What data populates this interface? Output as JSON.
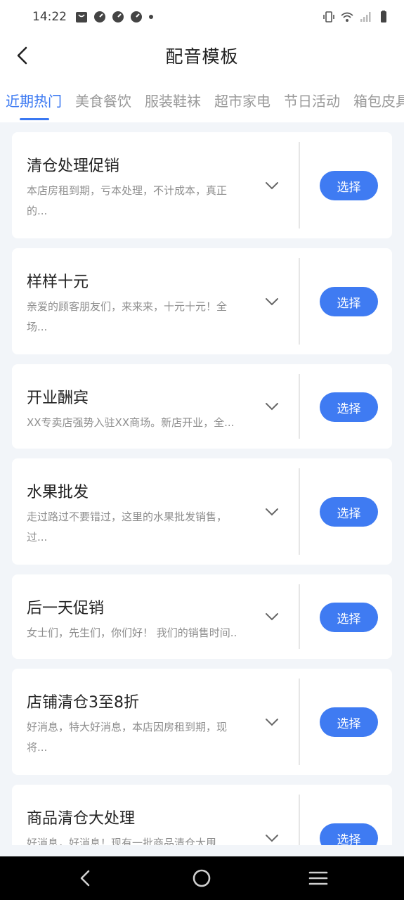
{
  "status": {
    "time": "14:22"
  },
  "header": {
    "title": "配音模板"
  },
  "tabs": [
    {
      "label": "近期热门",
      "active": true
    },
    {
      "label": "美食餐饮",
      "active": false
    },
    {
      "label": "服装鞋袜",
      "active": false
    },
    {
      "label": "超市家电",
      "active": false
    },
    {
      "label": "节日活动",
      "active": false
    },
    {
      "label": "箱包皮具",
      "active": false
    }
  ],
  "templates": [
    {
      "title": "清仓处理促销",
      "desc": "本店房租到期，亏本处理，不计成本，真正的...",
      "button": "选择"
    },
    {
      "title": "样样十元",
      "desc": "亲爱的顾客朋友们，来来来，十元十元！全场...",
      "button": "选择"
    },
    {
      "title": "开业酬宾",
      "desc": "XX专卖店强势入驻XX商场。新店开业，全...",
      "button": "选择"
    },
    {
      "title": "水果批发",
      "desc": "走过路过不要错过，这里的水果批发销售，过...",
      "button": "选择"
    },
    {
      "title": "后一天促销",
      "desc": "女士们，先生们，你们好！ 我们的销售时间...",
      "button": "选择"
    },
    {
      "title": "店铺清仓3至8折",
      "desc": "好消息，特大好消息，本店因房租到期，现将...",
      "button": "选择"
    },
    {
      "title": "商品清仓大处理",
      "desc": "好消息，好消息！现有一批商品清仓大甩",
      "button": "选择"
    }
  ],
  "colors": {
    "accent": "#3a78f2",
    "button": "#3f7bf2",
    "list_background": "#f2f5f9"
  },
  "icons": {
    "back": "chevron-left-icon",
    "expand": "chevron-down-icon",
    "nav_back": "nav-back-icon",
    "nav_home": "nav-home-icon",
    "nav_menu": "nav-menu-icon"
  }
}
